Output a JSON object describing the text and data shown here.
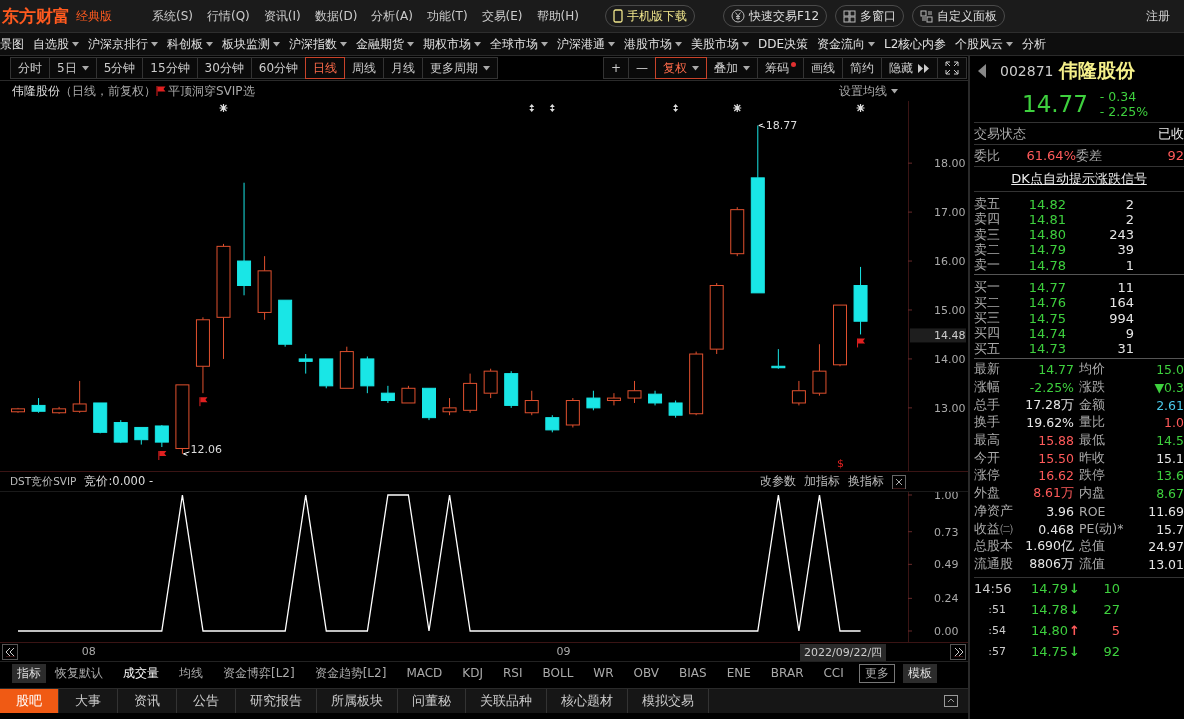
{
  "app": {
    "logo": "东方财富",
    "edition": "经典版",
    "menu": [
      "系统(S)",
      "行情(Q)",
      "资讯(I)",
      "数据(D)",
      "分析(A)",
      "功能(T)",
      "交易(E)",
      "帮助(H)"
    ],
    "buttons": [
      {
        "label": "手机版下载",
        "kind": "phone"
      },
      {
        "label": "快速交易F12",
        "kind": "yen"
      },
      {
        "label": "多窗口",
        "kind": "grid"
      },
      {
        "label": "自定义面板",
        "kind": "panel"
      }
    ],
    "login": "注册"
  },
  "nav": [
    {
      "label": "景图",
      "dropdown": false
    },
    {
      "label": "自选股",
      "dropdown": true
    },
    {
      "label": "沪深京排行",
      "dropdown": true
    },
    {
      "label": "科创板",
      "dropdown": true
    },
    {
      "label": "板块监测",
      "dropdown": true
    },
    {
      "label": "沪深指数",
      "dropdown": true
    },
    {
      "label": "金融期货",
      "dropdown": true
    },
    {
      "label": "期权市场",
      "dropdown": true
    },
    {
      "label": "全球市场",
      "dropdown": true
    },
    {
      "label": "沪深港通",
      "dropdown": true
    },
    {
      "label": "港股市场",
      "dropdown": true
    },
    {
      "label": "美股市场",
      "dropdown": true
    },
    {
      "label": "DDE决策",
      "dropdown": false
    },
    {
      "label": "资金流向",
      "dropdown": true
    },
    {
      "label": "L2核心内参",
      "dropdown": false
    },
    {
      "label": "个股风云",
      "dropdown": true
    },
    {
      "label": "分析",
      "dropdown": false
    }
  ],
  "periods": [
    {
      "label": "分时",
      "selected": false,
      "dropdown": false
    },
    {
      "label": "5日",
      "selected": false,
      "dropdown": true
    },
    {
      "label": "5分钟",
      "selected": false,
      "dropdown": false
    },
    {
      "label": "15分钟",
      "selected": false,
      "dropdown": false
    },
    {
      "label": "30分钟",
      "selected": false,
      "dropdown": false
    },
    {
      "label": "60分钟",
      "selected": false,
      "dropdown": false
    },
    {
      "label": "日线",
      "selected": true,
      "dropdown": false
    },
    {
      "label": "周线",
      "selected": false,
      "dropdown": false
    },
    {
      "label": "月线",
      "selected": false,
      "dropdown": false
    },
    {
      "label": "更多周期",
      "selected": false,
      "dropdown": true
    }
  ],
  "tools": [
    {
      "kind": "text",
      "label": "+",
      "selected": false,
      "dropdown": false,
      "dot": false
    },
    {
      "kind": "text",
      "label": "—",
      "selected": false,
      "dropdown": false,
      "dot": false
    },
    {
      "kind": "text",
      "label": "复权",
      "selected": true,
      "dropdown": true,
      "dot": false
    },
    {
      "kind": "text",
      "label": "叠加",
      "selected": false,
      "dropdown": true,
      "dot": false
    },
    {
      "kind": "text",
      "label": "筹码",
      "selected": false,
      "dropdown": false,
      "dot": true
    },
    {
      "kind": "text",
      "label": "画线",
      "selected": false,
      "dropdown": false,
      "dot": false
    },
    {
      "kind": "text",
      "label": "简约",
      "selected": false,
      "dropdown": false,
      "dot": false
    },
    {
      "kind": "collapse",
      "label": "隐藏",
      "selected": false,
      "dropdown": false,
      "dot": false
    },
    {
      "kind": "fullscreen",
      "selected": false,
      "dropdown": false,
      "dot": false
    }
  ],
  "chart": {
    "stock": "伟隆股份",
    "mode": "（日线，前复权）",
    "signal": "平顶洞穿SVIP选",
    "ma_button": "设置均线",
    "current_price": "14.48",
    "chart_data": {
      "type": "candlestick",
      "ylim": [
        11.71,
        19.27
      ],
      "yticks": [
        {
          "value": 18,
          "label": "18.00"
        },
        {
          "value": 17,
          "label": "17.00"
        },
        {
          "value": 16,
          "label": "16.00"
        },
        {
          "value": 15,
          "label": "15.00"
        },
        {
          "value": 14,
          "label": "14.00"
        },
        {
          "value": 13,
          "label": "13.00"
        }
      ],
      "ohlc": [
        [
          12.92,
          13.0,
          12.9,
          12.98
        ],
        [
          13.05,
          13.2,
          12.9,
          12.93
        ],
        [
          12.9,
          13.02,
          12.88,
          12.98
        ],
        [
          12.93,
          13.55,
          12.9,
          13.08
        ],
        [
          13.1,
          13.1,
          12.48,
          12.5
        ],
        [
          12.7,
          12.75,
          12.28,
          12.3
        ],
        [
          12.6,
          12.6,
          12.25,
          12.35
        ],
        [
          12.63,
          12.65,
          12.2,
          12.3
        ],
        [
          12.17,
          13.47,
          12.06,
          13.47
        ],
        [
          13.85,
          14.85,
          13.3,
          14.8
        ],
        [
          14.85,
          16.35,
          14.0,
          16.3
        ],
        [
          16.0,
          17.6,
          15.3,
          15.5
        ],
        [
          14.95,
          16.1,
          14.8,
          15.8
        ],
        [
          15.2,
          15.2,
          14.25,
          14.3
        ],
        [
          14.0,
          14.1,
          13.7,
          13.95
        ],
        [
          14.0,
          14.0,
          13.4,
          13.45
        ],
        [
          13.4,
          14.25,
          13.4,
          14.15
        ],
        [
          14.0,
          14.05,
          13.3,
          13.45
        ],
        [
          13.3,
          13.45,
          13.1,
          13.15
        ],
        [
          13.1,
          13.45,
          13.1,
          13.4
        ],
        [
          13.4,
          13.4,
          12.75,
          12.8
        ],
        [
          12.92,
          13.2,
          12.85,
          13.0
        ],
        [
          12.95,
          13.7,
          12.9,
          13.5
        ],
        [
          13.3,
          13.8,
          13.2,
          13.75
        ],
        [
          13.7,
          13.75,
          13.0,
          13.05
        ],
        [
          12.9,
          13.35,
          12.85,
          13.15
        ],
        [
          12.8,
          12.85,
          12.5,
          12.55
        ],
        [
          12.65,
          13.2,
          12.6,
          13.15
        ],
        [
          13.2,
          13.35,
          12.95,
          13.0
        ],
        [
          13.15,
          13.3,
          13.05,
          13.2
        ],
        [
          13.2,
          13.55,
          13.1,
          13.35
        ],
        [
          13.28,
          13.35,
          13.05,
          13.1
        ],
        [
          13.1,
          13.15,
          12.8,
          12.85
        ],
        [
          12.88,
          14.15,
          12.85,
          14.1
        ],
        [
          14.2,
          15.55,
          14.1,
          15.5
        ],
        [
          16.15,
          17.1,
          16.1,
          17.05
        ],
        [
          17.7,
          18.77,
          15.35,
          15.35
        ],
        [
          13.85,
          14.2,
          13.8,
          13.82
        ],
        [
          13.1,
          13.55,
          13.05,
          13.35
        ],
        [
          13.3,
          14.3,
          13.25,
          13.75
        ],
        [
          13.88,
          15.1,
          13.85,
          15.1
        ],
        [
          15.5,
          15.88,
          14.5,
          14.77
        ]
      ],
      "annotations": [
        "18.77",
        "12.06",
        "$"
      ]
    }
  },
  "indicator": {
    "name": "DST竞价SVIP",
    "reading": ":0.000 -",
    "actions": [
      "改参数",
      "加指标",
      "换指标"
    ],
    "chart_data": {
      "type": "line",
      "ylim": [
        -0.081,
        1.022
      ],
      "yticks": [
        {
          "value": 1,
          "label": "1.00"
        },
        {
          "value": 0.73,
          "label": "0.73"
        },
        {
          "value": 0.49,
          "label": "0.49"
        },
        {
          "value": 0.24,
          "label": "0.24"
        },
        {
          "value": 0,
          "label": "0.00"
        }
      ],
      "series": [
        {
          "name": "竞价",
          "color": "#ffffff",
          "values": [
            0,
            0,
            0,
            0,
            0,
            0,
            0,
            0,
            1,
            0,
            0,
            0,
            0,
            0,
            1,
            0,
            0,
            0,
            1,
            1,
            0,
            1,
            0,
            0,
            0,
            0,
            0,
            0,
            0,
            0,
            0,
            0,
            0,
            0,
            0,
            0,
            0,
            1,
            0,
            1,
            0,
            0
          ]
        }
      ]
    },
    "month_labels": [
      "08",
      "09"
    ],
    "date": "2022/09/22/四"
  },
  "indicator_tabs": [
    {
      "label": "指标",
      "kind": "label",
      "selected": false
    },
    {
      "label": "恢复默认",
      "kind": "item",
      "selected": false
    },
    {
      "label": "成交量",
      "kind": "item",
      "selected": true
    },
    {
      "label": "均线",
      "kind": "item",
      "selected": false
    },
    {
      "label": "资金博弈[L2]",
      "kind": "item",
      "selected": false
    },
    {
      "label": "资金趋势[L2]",
      "kind": "item",
      "selected": false
    },
    {
      "label": "MACD",
      "kind": "item",
      "selected": false
    },
    {
      "label": "KDJ",
      "kind": "item",
      "selected": false
    },
    {
      "label": "RSI",
      "kind": "item",
      "selected": false
    },
    {
      "label": "BOLL",
      "kind": "item",
      "selected": false
    },
    {
      "label": "WR",
      "kind": "item",
      "selected": false
    },
    {
      "label": "OBV",
      "kind": "item",
      "selected": false
    },
    {
      "label": "BIAS",
      "kind": "item",
      "selected": false
    },
    {
      "label": "ENE",
      "kind": "item",
      "selected": false
    },
    {
      "label": "BRAR",
      "kind": "item",
      "selected": false
    },
    {
      "label": "CCI",
      "kind": "item",
      "selected": false
    },
    {
      "label": "更多",
      "kind": "more",
      "selected": false
    },
    {
      "label": "模板",
      "kind": "template",
      "selected": false
    }
  ],
  "bottom_tabs": [
    {
      "label": "股吧",
      "selected": true
    },
    {
      "label": "大事",
      "selected": false
    },
    {
      "label": "资讯",
      "selected": false
    },
    {
      "label": "公告",
      "selected": false
    },
    {
      "label": "研究报告",
      "selected": false
    },
    {
      "label": "所属板块",
      "selected": false
    },
    {
      "label": "问董秘",
      "selected": false
    },
    {
      "label": "关联品种",
      "selected": false
    },
    {
      "label": "核心题材",
      "selected": false
    },
    {
      "label": "模拟交易",
      "selected": false
    }
  ],
  "quote": {
    "code": "002871",
    "name": "伟隆股份",
    "price": "14.77",
    "change": "- 0.34",
    "change_pct": "- 2.25%",
    "status_label": "交易状态",
    "status": "已收",
    "ratio": {
      "label": "委比",
      "value": "61.64%",
      "diff_label": "委差",
      "diff": "92"
    },
    "link": "DK点自动提示涨跌信号",
    "asks": [
      {
        "label": "卖五",
        "price": "14.82",
        "volume": "2"
      },
      {
        "label": "卖四",
        "price": "14.81",
        "volume": "2"
      },
      {
        "label": "卖三",
        "price": "14.80",
        "volume": "243"
      },
      {
        "label": "卖二",
        "price": "14.79",
        "volume": "39"
      },
      {
        "label": "卖一",
        "price": "14.78",
        "volume": "1"
      }
    ],
    "bids": [
      {
        "label": "买一",
        "price": "14.77",
        "volume": "11"
      },
      {
        "label": "买二",
        "price": "14.76",
        "volume": "164"
      },
      {
        "label": "买三",
        "price": "14.75",
        "volume": "994"
      },
      {
        "label": "买四",
        "price": "14.74",
        "volume": "9"
      },
      {
        "label": "买五",
        "price": "14.73",
        "volume": "31"
      }
    ],
    "stats": [
      [
        {
          "label": "最新",
          "value": "14.77",
          "color": "#3ed03e"
        },
        {
          "label": "均价",
          "value": "15.0",
          "color": "#3ed03e"
        }
      ],
      [
        {
          "label": "涨幅",
          "value": "-2.25%",
          "color": "#3ed03e"
        },
        {
          "label": "涨跌",
          "value": "▼0.3",
          "color": "#3ed03e"
        }
      ],
      [
        {
          "label": "总手",
          "value": "17.28万",
          "color": "#e6e6e6"
        },
        {
          "label": "金额",
          "value": "2.61",
          "color": "#4ac8e8"
        }
      ],
      [
        {
          "label": "换手",
          "value": "19.62%",
          "color": "#e6e6e6"
        },
        {
          "label": "量比",
          "value": "1.0",
          "color": "#ff5a5a"
        }
      ],
      [
        {
          "label": "最高",
          "value": "15.88",
          "color": "#ff5a5a"
        },
        {
          "label": "最低",
          "value": "14.5",
          "color": "#3ed03e"
        }
      ],
      [
        {
          "label": "今开",
          "value": "15.50",
          "color": "#ff5a5a"
        },
        {
          "label": "昨收",
          "value": "15.1",
          "color": "#e6e6e6"
        }
      ],
      [
        {
          "label": "涨停",
          "value": "16.62",
          "color": "#ff5a5a"
        },
        {
          "label": "跌停",
          "value": "13.6",
          "color": "#3ed03e"
        }
      ],
      [
        {
          "label": "外盘",
          "value": "8.61万",
          "color": "#ff5a5a"
        },
        {
          "label": "内盘",
          "value": "8.67",
          "color": "#3ed03e"
        }
      ],
      [
        {
          "label": "净资产",
          "value": "3.96",
          "color": "#e6e6e6"
        },
        {
          "label": "ROE",
          "value": "11.69",
          "color": "#e6e6e6"
        }
      ],
      [
        {
          "label": "收益㈡",
          "value": "0.468",
          "color": "#e6e6e6"
        },
        {
          "label": "PE(动)*",
          "value": "15.7",
          "color": "#e6e6e6"
        }
      ],
      [
        {
          "label": "总股本",
          "value": "1.690亿",
          "color": "#e6e6e6"
        },
        {
          "label": "总值",
          "value": "24.97",
          "color": "#e6e6e6"
        }
      ],
      [
        {
          "label": "流通股",
          "value": "8806万",
          "color": "#e6e6e6"
        },
        {
          "label": "流值",
          "value": "13.01",
          "color": "#e6e6e6"
        }
      ]
    ],
    "ticks": [
      {
        "time": "14:56",
        "price": "14.79",
        "arrow": "↓",
        "volume": "10",
        "color": "#3ed03e"
      },
      {
        "time": ":51",
        "price": "14.78",
        "arrow": "↓",
        "volume": "27",
        "color": "#3ed03e"
      },
      {
        "time": ":54",
        "price": "14.80",
        "arrow": "↑",
        "volume": "5",
        "color": "#ff5a5a"
      },
      {
        "time": ":57",
        "price": "14.75",
        "arrow": "↓",
        "volume": "92",
        "color": "#3ed03e"
      }
    ]
  }
}
